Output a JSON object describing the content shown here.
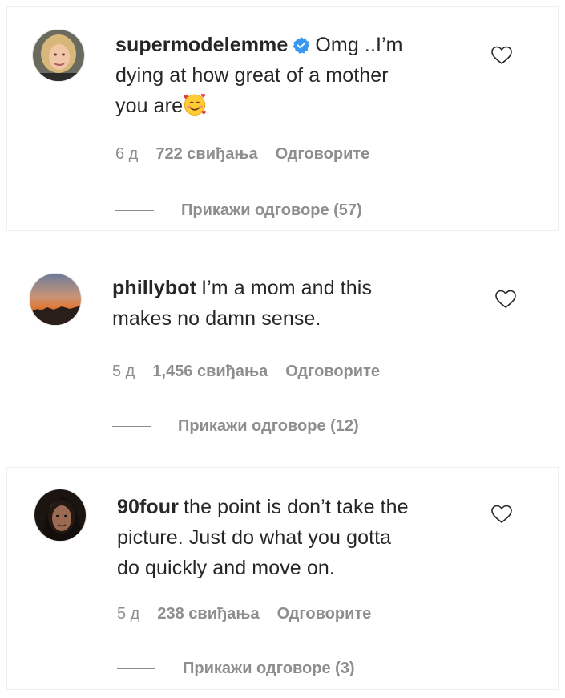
{
  "comments": [
    {
      "username": "supermodelemme",
      "verified": true,
      "text_line1": "Omg ..I’m",
      "text_line2": "dying at how great of a mother",
      "text_line3": "you are",
      "emoji": "smiling-face-with-hearts",
      "time": "6 д",
      "likes": "722 свиђања",
      "reply_label": "Одговорите",
      "view_replies": "Прикажи одговоре (57)"
    },
    {
      "username": "phillybot",
      "verified": false,
      "text_line1": "I’m a mom and this",
      "text_line2": "makes no damn sense.",
      "time": "5 д",
      "likes": "1,456 свиђања",
      "reply_label": "Одговорите",
      "view_replies": "Прикажи одговоре (12)"
    },
    {
      "username": "90four",
      "verified": false,
      "text_line1": "the point is don’t take the",
      "text_line2": "picture. Just do what you gotta",
      "text_line3": "do quickly and move on.",
      "time": "5 д",
      "likes": "238 свиђања",
      "reply_label": "Одговорите",
      "view_replies": "Прикажи одговоре (3)"
    }
  ],
  "colors": {
    "text": "#262626",
    "secondary": "#8e8e8e",
    "verified": "#3897f0",
    "border": "#efefef"
  }
}
